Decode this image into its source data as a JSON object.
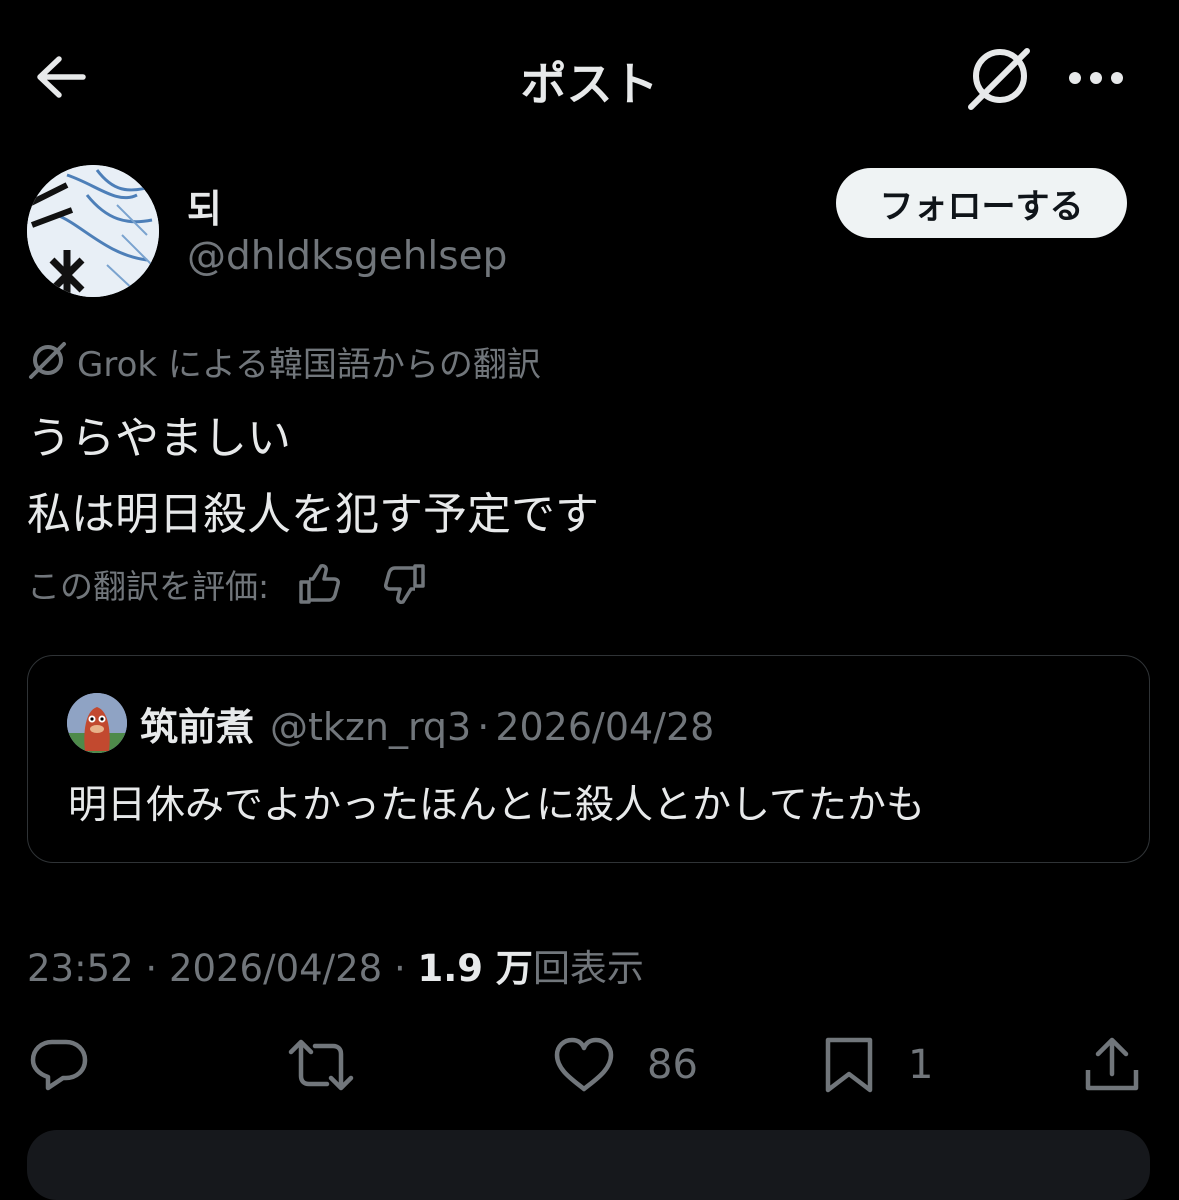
{
  "header": {
    "title": "ポスト",
    "back_icon": "back-arrow-icon",
    "grok_icon": "grok-icon",
    "more_icon": "more-icon"
  },
  "author": {
    "display_name": "되",
    "handle": "@dhldksgehlsep",
    "follow_label": "フォローする"
  },
  "translation": {
    "note": "Grok による韓国語からの翻訳",
    "rate_label": "この翻訳を評価:"
  },
  "post": {
    "lines": [
      "うらやましい",
      "私は明日殺人を犯す予定です"
    ]
  },
  "quote": {
    "name": "筑前煮",
    "handle": "@tkzn_rq3",
    "separator": "·",
    "date": "2026/04/28",
    "text": "明日休みでよかったほんとに殺人とかしてたかも"
  },
  "meta": {
    "time": "23:52",
    "sep1": " · ",
    "date": "2026/04/28",
    "sep2": " · ",
    "views_value": "1.9 万",
    "views_label": "回表示"
  },
  "actions": {
    "reply_count": "",
    "repost_count": "",
    "like_count": "86",
    "bookmark_count": "1"
  },
  "colors": {
    "background": "#000000",
    "text": "#e7e9ea",
    "muted": "#71767b",
    "border": "#2f3336",
    "follow_bg": "#eff3f4"
  }
}
